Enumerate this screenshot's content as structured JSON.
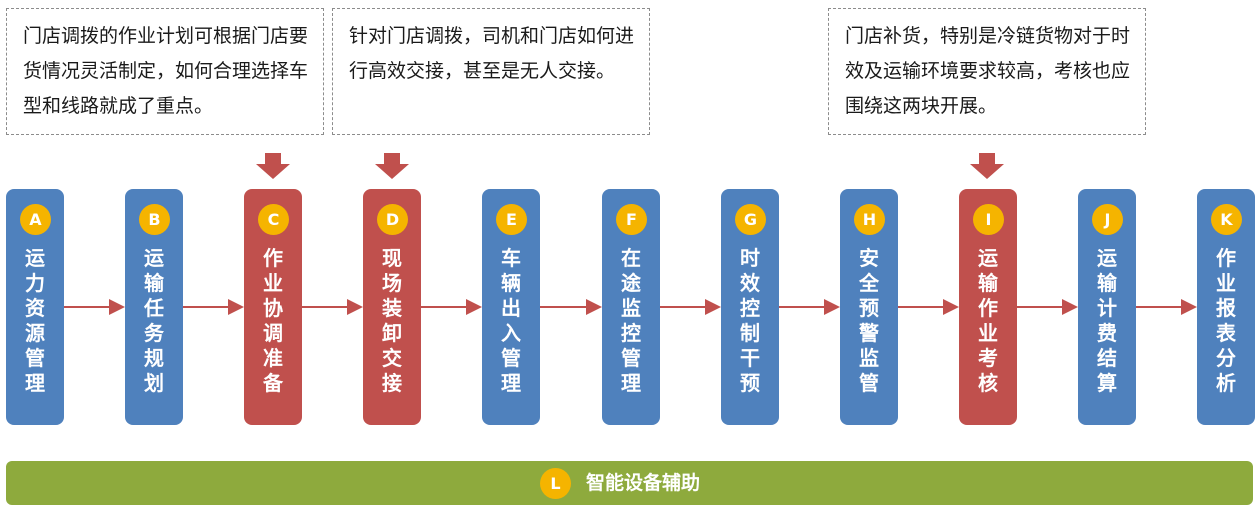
{
  "notes": {
    "c": "门店调拨的作业计划可根据门店要货情况灵活制定，如何合理选择车型和线路就成了重点。",
    "d": "针对门店调拨，司机和门店如何进行高效交接，甚至是无人交接。",
    "i": "门店补货，特别是冷链货物对于时效及运输环境要求较高，考核也应围绕这两块开展。"
  },
  "steps": [
    {
      "letter": "A",
      "label": "运力资源管理",
      "highlight": false
    },
    {
      "letter": "B",
      "label": "运输任务规划",
      "highlight": false
    },
    {
      "letter": "C",
      "label": "作业协调准备",
      "highlight": true
    },
    {
      "letter": "D",
      "label": "现场装卸交接",
      "highlight": true
    },
    {
      "letter": "E",
      "label": "车辆出入管理",
      "highlight": false
    },
    {
      "letter": "F",
      "label": "在途监控管理",
      "highlight": false
    },
    {
      "letter": "G",
      "label": "时效控制干预",
      "highlight": false
    },
    {
      "letter": "H",
      "label": "安全预警监管",
      "highlight": false
    },
    {
      "letter": "I",
      "label": "运输作业考核",
      "highlight": true
    },
    {
      "letter": "J",
      "label": "运输计费结算",
      "highlight": false
    },
    {
      "letter": "K",
      "label": "作业报表分析",
      "highlight": false
    }
  ],
  "bottom": {
    "letter": "L",
    "label": "智能设备辅助"
  },
  "colors": {
    "blue": "#4f81bd",
    "red": "#c0504d",
    "badge": "#f5b400",
    "green": "#8eaa3d",
    "arrow": "#c0504d"
  }
}
